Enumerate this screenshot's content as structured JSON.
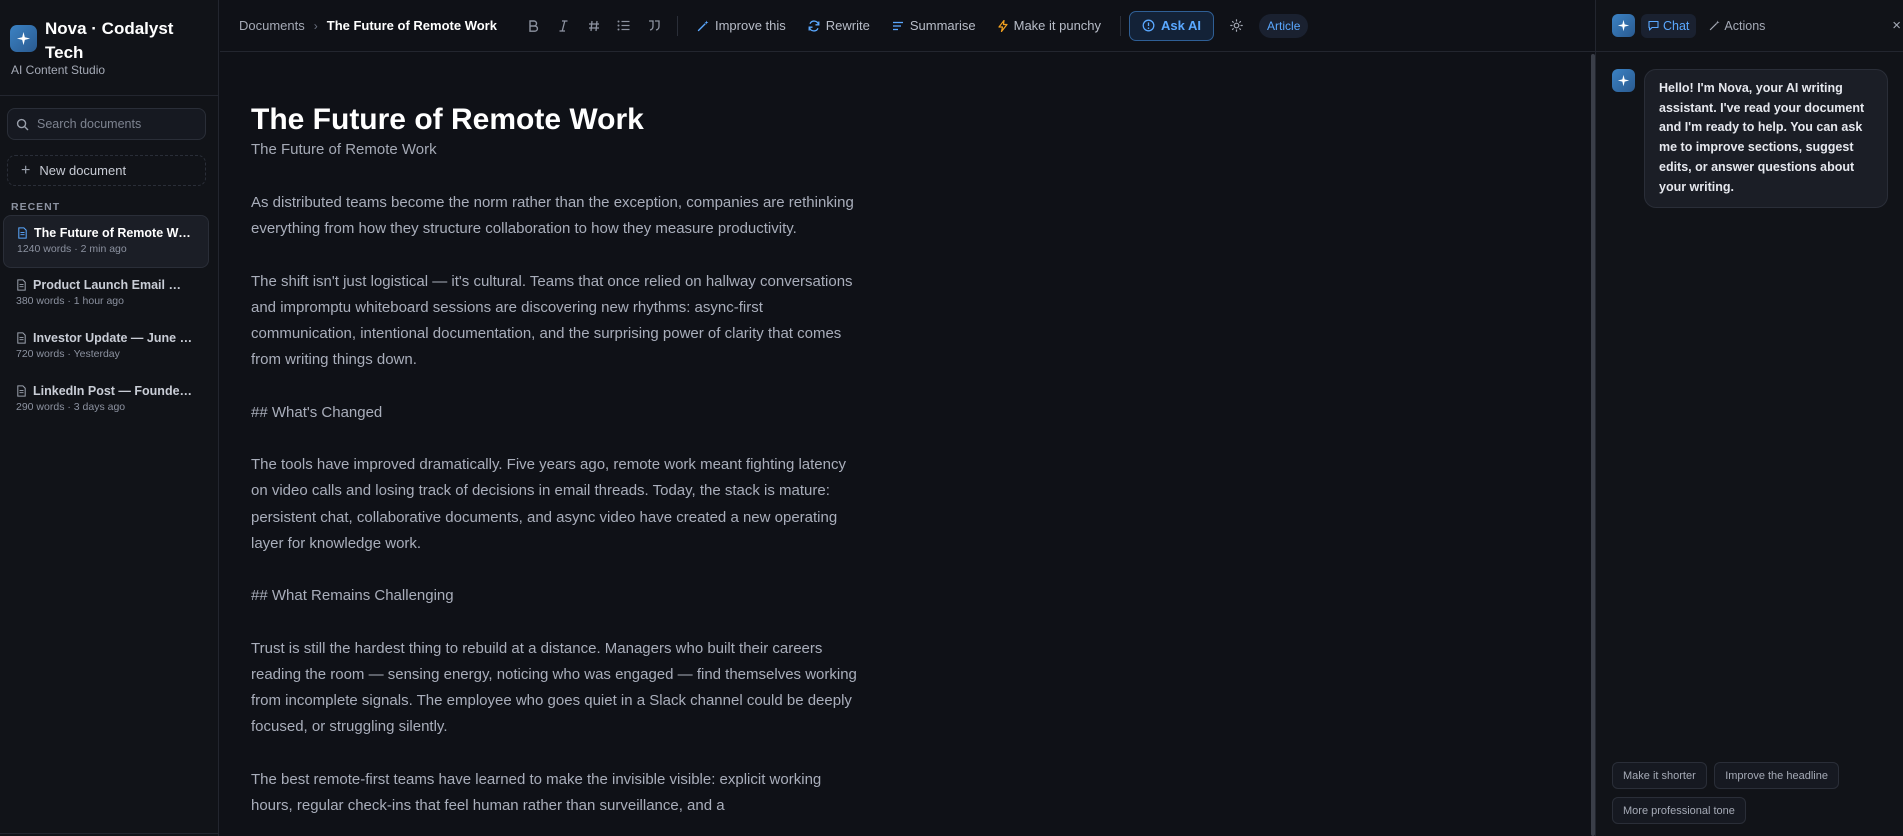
{
  "app": {
    "title": "Nova · Codalyst Tech",
    "subtitle": "AI Content Studio"
  },
  "sidebar": {
    "search_placeholder": "Search documents",
    "new_document_label": "New document",
    "recent_label": "RECENT",
    "documents": [
      {
        "title": "The Future of Remote Work",
        "meta": "1240 words · 2 min ago",
        "active": true
      },
      {
        "title": "Product Launch Email — …",
        "meta": "380 words · 1 hour ago",
        "active": false
      },
      {
        "title": "Investor Update — June 2…",
        "meta": "720 words · Yesterday",
        "active": false
      },
      {
        "title": "LinkedIn Post — Founder …",
        "meta": "290 words · 3 days ago",
        "active": false
      }
    ]
  },
  "toolbar": {
    "breadcrumb_root": "Documents",
    "breadcrumb_separator": "›",
    "breadcrumb_current": "The Future of Remote Work",
    "format_buttons": [
      "bold",
      "italic",
      "heading",
      "bullet-list",
      "quote"
    ],
    "improve_label": "Improve this",
    "rewrite_label": "Rewrite",
    "summarise_label": "Summarise",
    "punchy_label": "Make it punchy",
    "ask_ai_label": "Ask AI",
    "doc_type_label": "Article"
  },
  "document": {
    "title": "The Future of Remote Work",
    "subtitle": "The Future of Remote Work",
    "paragraphs": [
      "As distributed teams become the norm rather than the exception, companies are rethinking everything from how they structure collaboration to how they measure productivity.",
      "The shift isn't just logistical — it's cultural. Teams that once relied on hallway conversations and impromptu whiteboard sessions are discovering new rhythms: async-first communication, intentional documentation, and the surprising power of clarity that comes from writing things down.",
      "## What's Changed",
      "The tools have improved dramatically. Five years ago, remote work meant fighting latency on video calls and losing track of decisions in email threads. Today, the stack is mature: persistent chat, collaborative documents, and async video have created a new operating layer for knowledge work.",
      "## What Remains Challenging",
      "Trust is still the hardest thing to rebuild at a distance. Managers who built their careers reading the room — sensing energy, noticing who was engaged — find themselves working from incomplete signals. The employee who goes quiet in a Slack channel could be deeply focused, or struggling silently.",
      "The best remote-first teams have learned to make the invisible visible: explicit working hours, regular check-ins that feel human rather than surveillance, and a"
    ]
  },
  "chat": {
    "tab_chat": "Chat",
    "tab_actions": "Actions",
    "close_symbol": "×",
    "greeting": "Hello! I'm Nova, your AI writing assistant. I've read your document and I'm ready to help. You can ask me to improve sections, suggest edits, or answer questions about your writing.",
    "suggestions": [
      "Make it shorter",
      "Improve the headline",
      "More professional tone"
    ]
  },
  "colors": {
    "background": "#0f1117",
    "accent": "#5aa8ff",
    "brand_gradient_start": "#3b82c4",
    "punchy_icon": "#f0a020"
  }
}
